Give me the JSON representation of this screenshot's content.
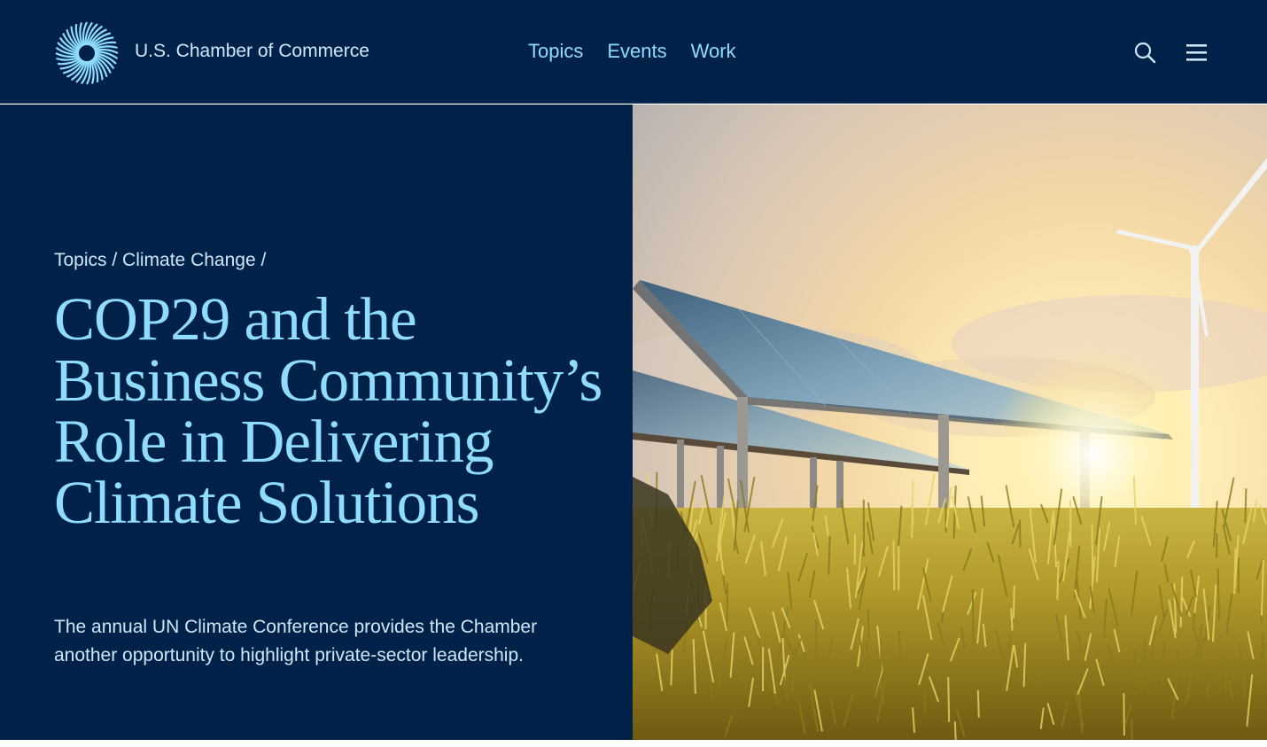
{
  "header": {
    "brand": "U.S. Chamber of Commerce",
    "nav": [
      "Topics",
      "Events",
      "Work"
    ],
    "icons": [
      "starburst-logo",
      "search-icon",
      "hamburger-menu-icon"
    ]
  },
  "hero": {
    "breadcrumb": [
      "Topics",
      "Climate Change"
    ],
    "breadcrumb_sep": " / ",
    "title": "COP29 and the Business Community’s Role in Delivering Climate Solutions",
    "lede": "The annual UN Climate Conference provides the Chamber another opportunity to highlight private-sector leadership."
  },
  "colors": {
    "navy": "#002249",
    "accent": "#8fdcff",
    "text_light": "#cfe6ff"
  }
}
